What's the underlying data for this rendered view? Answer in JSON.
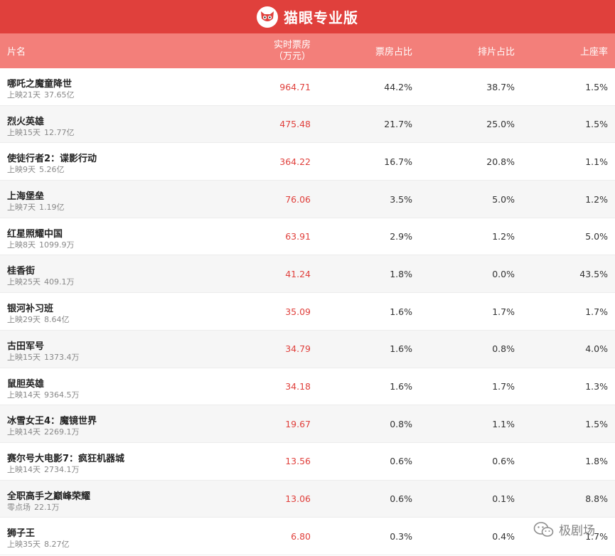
{
  "header": {
    "app_name": "猫眼专业版"
  },
  "table": {
    "columns": {
      "name": "片名",
      "box_line1": "实时票房",
      "box_line2": "（万元）",
      "box_ratio": "票房占比",
      "show_ratio": "排片占比",
      "seat_rate": "上座率"
    },
    "rows": [
      {
        "title": "哪吒之魔童降世",
        "days": "上映21天",
        "total": "37.65亿",
        "box": "964.71",
        "box_ratio": "44.2%",
        "show_ratio": "38.7%",
        "seat_rate": "1.5%"
      },
      {
        "title": "烈火英雄",
        "days": "上映15天",
        "total": "12.77亿",
        "box": "475.48",
        "box_ratio": "21.7%",
        "show_ratio": "25.0%",
        "seat_rate": "1.5%"
      },
      {
        "title": "使徒行者2：谍影行动",
        "days": "上映9天",
        "total": "5.26亿",
        "box": "364.22",
        "box_ratio": "16.7%",
        "show_ratio": "20.8%",
        "seat_rate": "1.1%"
      },
      {
        "title": "上海堡垒",
        "days": "上映7天",
        "total": "1.19亿",
        "box": "76.06",
        "box_ratio": "3.5%",
        "show_ratio": "5.0%",
        "seat_rate": "1.2%"
      },
      {
        "title": "红星照耀中国",
        "days": "上映8天",
        "total": "1099.9万",
        "box": "63.91",
        "box_ratio": "2.9%",
        "show_ratio": "1.2%",
        "seat_rate": "5.0%"
      },
      {
        "title": "桂香街",
        "days": "上映25天",
        "total": "409.1万",
        "box": "41.24",
        "box_ratio": "1.8%",
        "show_ratio": "0.0%",
        "seat_rate": "43.5%"
      },
      {
        "title": "银河补习班",
        "days": "上映29天",
        "total": "8.64亿",
        "box": "35.09",
        "box_ratio": "1.6%",
        "show_ratio": "1.7%",
        "seat_rate": "1.7%"
      },
      {
        "title": "古田军号",
        "days": "上映15天",
        "total": "1373.4万",
        "box": "34.79",
        "box_ratio": "1.6%",
        "show_ratio": "0.8%",
        "seat_rate": "4.0%"
      },
      {
        "title": "鼠胆英雄",
        "days": "上映14天",
        "total": "9364.5万",
        "box": "34.18",
        "box_ratio": "1.6%",
        "show_ratio": "1.7%",
        "seat_rate": "1.3%"
      },
      {
        "title": "冰雪女王4：魔镜世界",
        "days": "上映14天",
        "total": "2269.1万",
        "box": "19.67",
        "box_ratio": "0.8%",
        "show_ratio": "1.1%",
        "seat_rate": "1.5%"
      },
      {
        "title": "赛尔号大电影7：疯狂机器城",
        "days": "上映14天",
        "total": "2734.1万",
        "box": "13.56",
        "box_ratio": "0.6%",
        "show_ratio": "0.6%",
        "seat_rate": "1.8%"
      },
      {
        "title": "全职高手之巅峰荣耀",
        "days": "零点场",
        "total": "22.1万",
        "box": "13.06",
        "box_ratio": "0.6%",
        "show_ratio": "0.1%",
        "seat_rate": "8.8%"
      },
      {
        "title": "狮子王",
        "days": "上映35天",
        "total": "8.27亿",
        "box": "6.80",
        "box_ratio": "0.3%",
        "show_ratio": "0.4%",
        "seat_rate": "1.7%"
      }
    ]
  },
  "watermark": {
    "text": "极剧场"
  },
  "colors": {
    "brand_red": "#e0403c",
    "header_pink": "#f37f7a",
    "box_red": "#e0403c"
  }
}
